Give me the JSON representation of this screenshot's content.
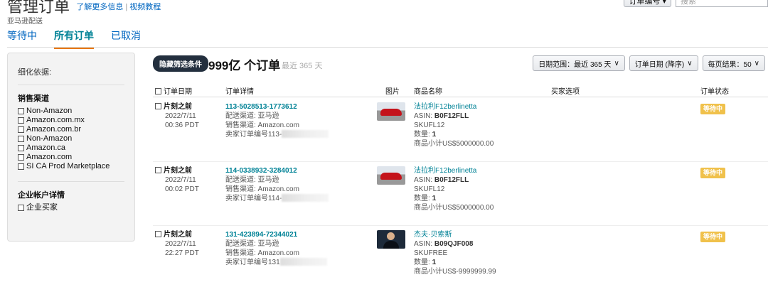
{
  "header": {
    "title": "管理订单",
    "link_more": "了解更多信息",
    "link_sep": "|",
    "link_video": "视频教程",
    "subtitle": "亚马逊配送"
  },
  "top_controls": {
    "order_id_select": "订单编号 ▾",
    "search_placeholder": "搜索"
  },
  "tabs": [
    {
      "label": "等待中",
      "active": false
    },
    {
      "label": "所有订单",
      "active": true
    },
    {
      "label": "已取消",
      "active": false
    }
  ],
  "sidebar": {
    "refine_label": "细化依据:",
    "channel_title": "销售渠道",
    "channels": [
      "Non-Amazon",
      "Amazon.com.mx",
      "Amazon.com.br",
      "Non-Amazon",
      "Amazon.ca",
      "Amazon.com",
      "SI CA Prod Marketplace"
    ],
    "business_title": "企业帐户详情",
    "business_options": [
      "企业买家"
    ]
  },
  "summary": {
    "hide_filters": "隐藏筛选条件",
    "count": "999亿 个订单",
    "range_note": "最近 365 天"
  },
  "controls": {
    "date_range": "日期范围：最近 365 天",
    "sort": "订单日期 (降序)",
    "per_page": "每页结果：50",
    "chevron": "∨"
  },
  "columns": {
    "date": "订单日期",
    "detail": "订单详情",
    "image": "图片",
    "product": "商品名称",
    "buyer": "买家选项",
    "status": "订单状态"
  },
  "orders": [
    {
      "label": "片刻之前",
      "date": "2022/7/11",
      "time": "00:36 PDT",
      "order_id": "113-5028513-1773612",
      "fulfillment": "配送渠道: 亚马逊",
      "sales_channel": "销售渠道: Amazon.com",
      "seller_order": "卖家订单编号113-",
      "image": "car-thumbnail",
      "product_name": "法拉利F12berlinetta",
      "asin_label": "ASIN: ",
      "asin": "B0F12FLL",
      "sku": "SKUFL12",
      "qty_label": "数量: ",
      "qty": "1",
      "subtotal": "商品小计US$5000000.00",
      "status": "等待中"
    },
    {
      "label": "片刻之前",
      "date": "2022/7/11",
      "time": "00:02 PDT",
      "order_id": "114-0338932-3284012",
      "fulfillment": "配送渠道: 亚马逊",
      "sales_channel": "销售渠道: Amazon.com",
      "seller_order": "卖家订单编号114-",
      "image": "car-thumbnail",
      "product_name": "法拉利F12berlinetta",
      "asin_label": "ASIN: ",
      "asin": "B0F12FLL",
      "sku": "SKUFL12",
      "qty_label": "数量: ",
      "qty": "1",
      "subtotal": "商品小计US$5000000.00",
      "status": "等待中"
    },
    {
      "label": "片刻之前",
      "date": "2022/7/11",
      "time": "22:27 PDT",
      "order_id": "131-423894-72344021",
      "fulfillment": "配送渠道: 亚马逊",
      "sales_channel": "销售渠道: Amazon.com",
      "seller_order": "卖家订单编号131",
      "image": "person-thumbnail",
      "product_name": "杰夫·贝索斯",
      "asin_label": "ASIN: ",
      "asin": "B09QJF008",
      "sku": "SKUFREE",
      "qty_label": "数量: ",
      "qty": "1",
      "subtotal": "商品小计US$-9999999.99",
      "status": "等待中"
    }
  ],
  "colors": {
    "link": "#0066c0",
    "teal": "#008296",
    "tab_underline": "#e77600",
    "status_badge": "#f0c14b",
    "dark_button": "#232f3e"
  }
}
